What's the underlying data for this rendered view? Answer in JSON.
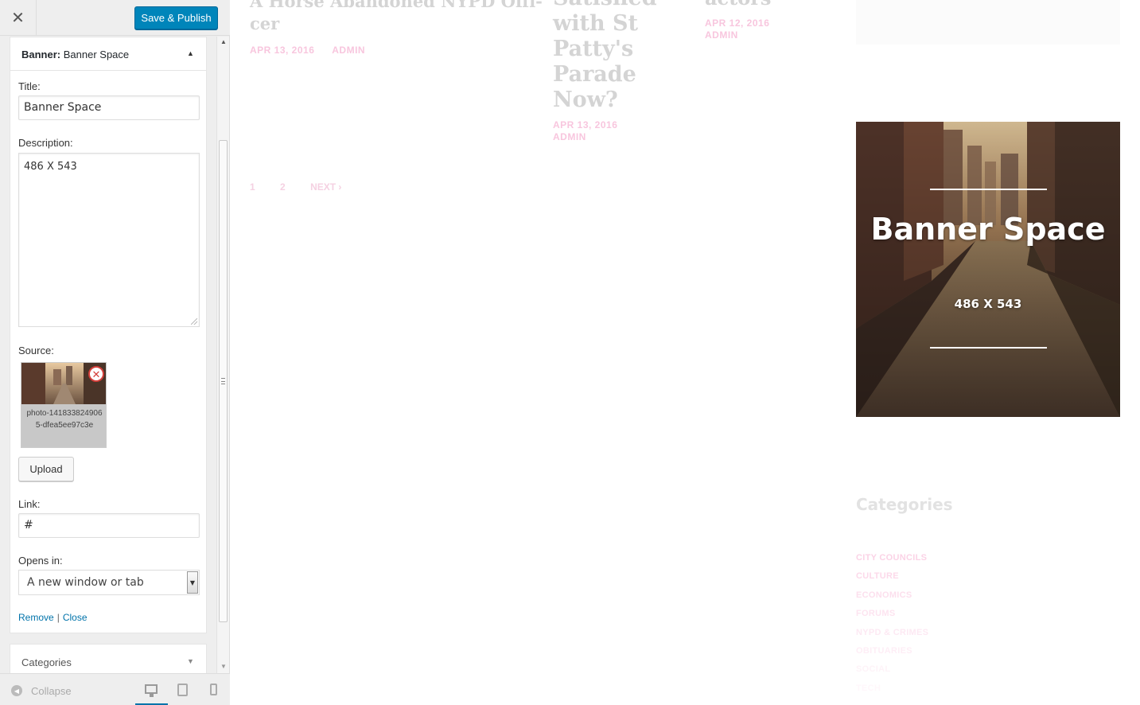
{
  "header": {
    "close_symbol": "✕",
    "save_label": "Save & Publish"
  },
  "widget": {
    "title_prefix": "Banner:",
    "title_name": "Banner Space",
    "expand_arrow": "▲",
    "title_label": "Title:",
    "title_value": "Banner Space",
    "description_label": "Description:",
    "description_value": "486 X 543",
    "source_label": "Source:",
    "source_filename": "photo-1418338249065-dfea5ee97c3e",
    "remove_symbol": "✕",
    "upload_label": "Upload",
    "link_label": "Link:",
    "link_value": "#",
    "opens_in_label": "Opens in:",
    "opens_in_value": "A new window or tab",
    "remove_link": "Remove",
    "close_link": "Close"
  },
  "categories_section": {
    "label": "Categories",
    "arrow": "▼"
  },
  "footer": {
    "collapse_label": "Collapse",
    "collapse_icon": "◀",
    "devices": [
      "desktop-icon",
      "tablet-icon",
      "mobile-icon"
    ]
  },
  "preview": {
    "posts": [
      {
        "title_lines": [
          "A Horse Abandoned NYPD Offi-",
          "cer"
        ],
        "date": "APR 13, 2016",
        "author": "ADMIN"
      },
      {
        "title_lines": [
          "Satisfied",
          "with St",
          "Patty's",
          "Parade",
          "Now?"
        ],
        "date": "APR 13, 2016",
        "author": "ADMIN"
      },
      {
        "title_lines": [
          "actors"
        ],
        "date": "APR 12, 2016",
        "author": "ADMIN"
      }
    ],
    "pagination": [
      "1",
      "2",
      "NEXT ›"
    ],
    "banner": {
      "title": "Banner Space",
      "subtitle": "486 X 543"
    },
    "categories_heading": "Categories",
    "categories": [
      "CITY COUNCILS",
      "CULTURE",
      "ECONOMICS",
      "FORUMS",
      "NYPD & CRIMES",
      "OBITUARIES",
      "SOCIAL",
      "TECH"
    ],
    "category_colors": [
      "#fbd3e6",
      "#fcd9ea",
      "#fcdfed",
      "#fde4f0",
      "#fde9f3",
      "#feeef6",
      "#fef3f8",
      "#fff7fb"
    ]
  },
  "colors": {
    "primary_button": "#0085ba",
    "link": "#0073aa",
    "post_meta_pink": "#f8c6de"
  }
}
